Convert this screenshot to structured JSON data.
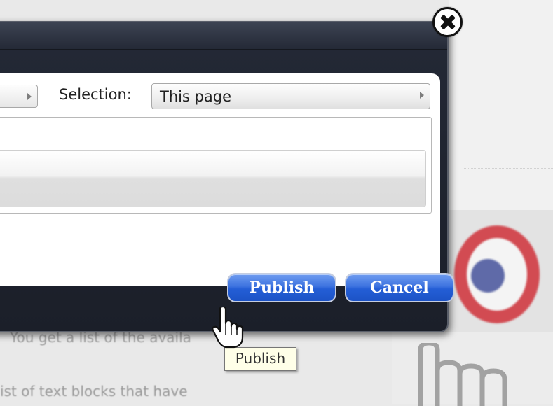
{
  "dialog": {
    "selection_label": "Selection:",
    "selection_value": "This page",
    "publish_label": "Publish",
    "cancel_label": "Cancel",
    "close_icon": "close-icon"
  },
  "tooltip": {
    "text": "Publish"
  },
  "background": {
    "line1": "You get a list of the availa",
    "line2": "ist of text blocks that have"
  },
  "colors": {
    "dialog_bg": "#1b1f29",
    "button_blue": "#245ed6",
    "target_red": "#d24b52",
    "target_blue": "#5f6aa8",
    "tooltip_bg": "#ffffe8"
  }
}
